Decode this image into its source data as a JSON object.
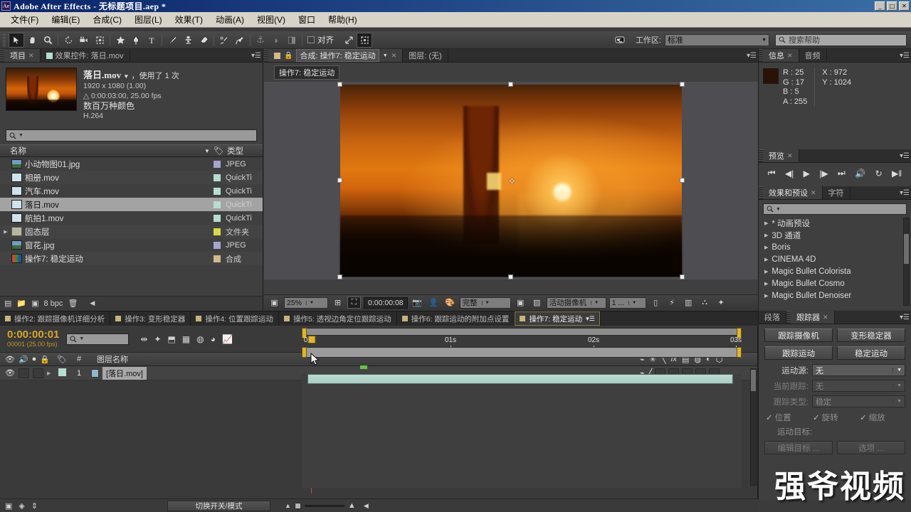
{
  "titlebar": {
    "logo": "Ae",
    "title": "Adobe After Effects - 无标题项目.aep *",
    "minimize": "_",
    "maximize": "□",
    "close": "✕"
  },
  "menubar": {
    "items": [
      "文件(F)",
      "编辑(E)",
      "合成(C)",
      "图层(L)",
      "效果(T)",
      "动画(A)",
      "视图(V)",
      "窗口",
      "帮助(H)"
    ]
  },
  "toolbar": {
    "tools": [
      {
        "name": "selection-tool",
        "glyph": "➤"
      },
      {
        "name": "hand-tool",
        "glyph": "✋"
      },
      {
        "name": "zoom-tool",
        "glyph": "🔍"
      },
      {
        "name": "rotation-tool",
        "glyph": "↻"
      },
      {
        "name": "camera-tool",
        "glyph": "🎥"
      },
      {
        "name": "pan-behind-tool",
        "glyph": "⛶"
      },
      {
        "name": "shape-tool",
        "glyph": "★"
      },
      {
        "name": "pen-tool",
        "glyph": "✒"
      },
      {
        "name": "text-tool",
        "glyph": "T"
      },
      {
        "name": "brush-tool",
        "glyph": "✎"
      },
      {
        "name": "clone-stamp-tool",
        "glyph": "⚲"
      },
      {
        "name": "eraser-tool",
        "glyph": "▱"
      },
      {
        "name": "roto-brush-tool",
        "glyph": "✐"
      },
      {
        "name": "puppet-pin-tool",
        "glyph": "📌"
      },
      {
        "name": "anchor-tool",
        "glyph": "⚓"
      },
      {
        "name": "mask-tool",
        "glyph": "◗"
      },
      {
        "name": "snapping-tool",
        "glyph": "◨"
      }
    ],
    "align_label": "对齐",
    "align_checked": false,
    "workspace_label": "工作区:",
    "workspace_value": "标准",
    "help_placeholder": "搜索帮助"
  },
  "project_panel": {
    "tabs": [
      {
        "label": "项目",
        "active": true,
        "closable": true
      },
      {
        "label": "效果控件: 落日.mov",
        "active": false,
        "closable": false
      }
    ],
    "selected_item": {
      "name": "落日.mov",
      "usage": "，使用了 1 次",
      "dimensions": "1920 x 1080 (1.00)",
      "duration": "0:00:03:00, 25.00 fps",
      "colors": "数百万种颜色",
      "codec": "H.264"
    },
    "search_placeholder": "",
    "columns": {
      "name": "名称",
      "type": "类型"
    },
    "files": [
      {
        "name": "小动物图01.jpg",
        "type": "JPEG",
        "icon": "image",
        "swatch": "#a7a3cf",
        "indent": 1,
        "selected": false,
        "expandable": false
      },
      {
        "name": "相册.mov",
        "type": "QuickTi",
        "icon": "movie",
        "swatch": "#b6ddd2",
        "indent": 1,
        "selected": false,
        "expandable": false
      },
      {
        "name": "汽车.mov",
        "type": "QuickTi",
        "icon": "movie",
        "swatch": "#b6ddd2",
        "indent": 1,
        "selected": false,
        "expandable": false
      },
      {
        "name": "落日.mov",
        "type": "QuickTi",
        "icon": "movie",
        "swatch": "#b6ddd2",
        "indent": 1,
        "selected": true,
        "expandable": false
      },
      {
        "name": "航拍1.mov",
        "type": "QuickTi",
        "icon": "movie",
        "swatch": "#b6ddd2",
        "indent": 1,
        "selected": false,
        "expandable": false
      },
      {
        "name": "固态层",
        "type": "文件夹",
        "icon": "folder",
        "swatch": "#d8d84a",
        "indent": 1,
        "selected": false,
        "expandable": true
      },
      {
        "name": "窗花.jpg",
        "type": "JPEG",
        "icon": "image",
        "swatch": "#a7a3cf",
        "indent": 1,
        "selected": false,
        "expandable": false
      },
      {
        "name": "操作7: 稳定运动",
        "type": "合成",
        "icon": "comp",
        "swatch": "#d4b98a",
        "indent": 1,
        "selected": false,
        "expandable": false
      },
      {
        "name": "操作6: 跟踪运动的附加点设置",
        "type": "合成",
        "icon": "comp",
        "swatch": "#d4b98a",
        "indent": 1,
        "selected": false,
        "expandable": false
      }
    ],
    "footer": {
      "bpc": "8 bpc"
    }
  },
  "comp_panel": {
    "tabs": [
      {
        "label": "合成: 操作7: 稳定运动",
        "active": true,
        "closable": true
      },
      {
        "label": "图层: (无)",
        "active": false,
        "closable": false
      }
    ],
    "breadcrumb": "操作7: 稳定运动",
    "toolbar": {
      "zoom": "25%",
      "timecode": "0:00:00:08",
      "resolution": "完整",
      "camera": "活动摄像机",
      "views": "1 ..."
    }
  },
  "info_panel": {
    "tabs": [
      {
        "label": "信息",
        "active": true,
        "closable": true
      },
      {
        "label": "音频",
        "active": false,
        "closable": false
      }
    ],
    "r": "R : 25",
    "g": "G : 17",
    "b": "B : 5",
    "a": "A : 255",
    "x": "X : 972",
    "y": "Y : 1024",
    "swatch_color": "#2a1207"
  },
  "preview_panel": {
    "tabs": [
      {
        "label": "预览",
        "active": true,
        "closable": true
      }
    ],
    "buttons": [
      {
        "name": "go-to-start-button",
        "glyph": "⏮"
      },
      {
        "name": "previous-frame-button",
        "glyph": "◀|"
      },
      {
        "name": "play-button",
        "glyph": "▶"
      },
      {
        "name": "next-frame-button",
        "glyph": "|▶"
      },
      {
        "name": "go-to-end-button",
        "glyph": "⏭"
      },
      {
        "name": "audio-toggle-button",
        "glyph": "🔊"
      },
      {
        "name": "loop-button",
        "glyph": "↻"
      },
      {
        "name": "ram-preview-button",
        "glyph": "▶‖"
      }
    ]
  },
  "effects_panel": {
    "tabs": [
      {
        "label": "效果和预设",
        "active": true,
        "closable": true
      },
      {
        "label": "字符",
        "active": false,
        "closable": false
      }
    ],
    "search_placeholder": "",
    "items": [
      "* 动画预设",
      "3D 通道",
      "Boris",
      "CINEMA 4D",
      "Magic Bullet Colorista",
      "Magic Bullet Cosmo",
      "Magic Bullet Denoiser"
    ]
  },
  "timeline_tabs": [
    {
      "label": "操作2: 跟踪摄像机详细分析",
      "active": false
    },
    {
      "label": "操作3: 变形稳定器",
      "active": false
    },
    {
      "label": "操作4: 位置跟踪运动",
      "active": false
    },
    {
      "label": "操作5: 透视边角定位跟踪运动",
      "active": false
    },
    {
      "label": "操作6: 跟踪运动的附加点设置",
      "active": false
    },
    {
      "label": "操作7: 稳定运动",
      "active": true
    }
  ],
  "timeline": {
    "current_time": "0:00:00:01",
    "frame_info": "00001 (25.00 fps)",
    "search_placeholder": "",
    "toolbar_icons": [
      {
        "name": "composition-mini-flowchart-icon",
        "glyph": "⇹"
      },
      {
        "name": "draft-3d-icon",
        "glyph": "✦"
      },
      {
        "name": "hide-shy-layers-icon",
        "glyph": "⬒"
      },
      {
        "name": "frame-blending-icon",
        "glyph": "▦"
      },
      {
        "name": "motion-blur-icon",
        "glyph": "◍"
      },
      {
        "name": "brainstorm-icon",
        "glyph": "◕"
      },
      {
        "name": "graph-editor-icon",
        "glyph": "📈"
      }
    ],
    "columns": {
      "name": "图层名称",
      "number": "#"
    },
    "layers": [
      {
        "index": "1",
        "name": "[落日.mov]",
        "color": "#b6ddd2",
        "visible": true
      }
    ],
    "ruler_labels": [
      "01s",
      "02s",
      "03s"
    ],
    "ruler_start": "0s"
  },
  "tracker_panel": {
    "tabs": [
      {
        "label": "段落",
        "active": false,
        "closable": false
      },
      {
        "label": "跟踪器",
        "active": true,
        "closable": true
      }
    ],
    "buttons": [
      {
        "label": "跟踪摄像机",
        "disabled": false
      },
      {
        "label": "变形稳定器",
        "disabled": false
      },
      {
        "label": "跟踪运动",
        "disabled": false
      },
      {
        "label": "稳定运动",
        "disabled": false
      }
    ],
    "fields": [
      {
        "label": "运动源:",
        "value": "无",
        "disabled": false
      },
      {
        "label": "当前跟踪:",
        "value": "无",
        "disabled": true
      },
      {
        "label": "跟踪类型:",
        "value": "稳定",
        "disabled": true
      }
    ],
    "checks": [
      {
        "label": "位置",
        "checked": true
      },
      {
        "label": "旋转",
        "checked": true
      },
      {
        "label": "缩放",
        "checked": true
      }
    ],
    "motion_target_label": "运动目标:",
    "edit_target_button": "编辑目标 ...",
    "options_button": "选项 ..."
  },
  "statusbar": {
    "toggle_switches_label": "切换开关/模式",
    "icons": [
      {
        "name": "layer-switches-icon",
        "glyph": "▣"
      },
      {
        "name": "transfer-controls-icon",
        "glyph": "◈"
      },
      {
        "name": "inout-panel-icon",
        "glyph": "⇕"
      }
    ]
  },
  "watermark": "强爷视频"
}
